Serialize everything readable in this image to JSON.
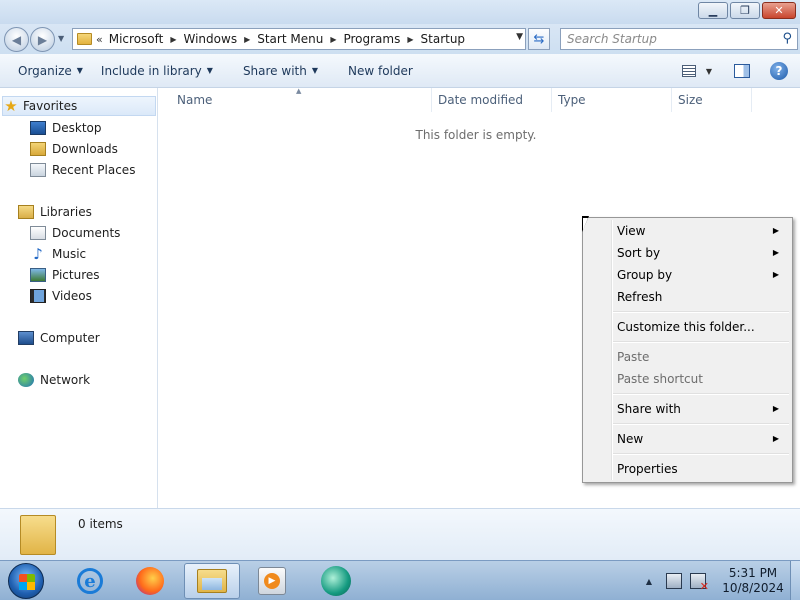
{
  "window": {
    "minimize_glyph": "▁",
    "maximize_glyph": "❐",
    "close_glyph": "✕"
  },
  "address": {
    "chevrons": "«",
    "breadcrumbs": [
      "Microsoft",
      "Windows",
      "Start Menu",
      "Programs",
      "Startup"
    ],
    "search_placeholder": "Search Startup"
  },
  "toolbar": {
    "organize": "Organize",
    "include_in_library": "Include in library",
    "share_with": "Share with",
    "new_folder": "New folder",
    "help": "?"
  },
  "navpane": {
    "favorites": "Favorites",
    "desktop": "Desktop",
    "downloads": "Downloads",
    "recent_places": "Recent Places",
    "libraries": "Libraries",
    "documents": "Documents",
    "music": "Music",
    "pictures": "Pictures",
    "videos": "Videos",
    "computer": "Computer",
    "network": "Network"
  },
  "columns": {
    "name": "Name",
    "date_modified": "Date modified",
    "type": "Type",
    "size": "Size"
  },
  "content": {
    "empty_message": "This folder is empty."
  },
  "details": {
    "item_count": "0 items"
  },
  "context_menu": {
    "view": "View",
    "sort_by": "Sort by",
    "group_by": "Group by",
    "refresh": "Refresh",
    "customize": "Customize this folder...",
    "paste": "Paste",
    "paste_shortcut": "Paste shortcut",
    "share_with": "Share with",
    "new": "New",
    "properties": "Properties"
  },
  "taskbar": {
    "time": "5:31 PM",
    "date": "10/8/2024"
  },
  "icons": {
    "back": "arrow-left-icon",
    "forward": "arrow-right-icon",
    "refresh": "refresh-icon",
    "search": "search-icon",
    "favorites": "star-icon",
    "music": "music-note-icon"
  }
}
